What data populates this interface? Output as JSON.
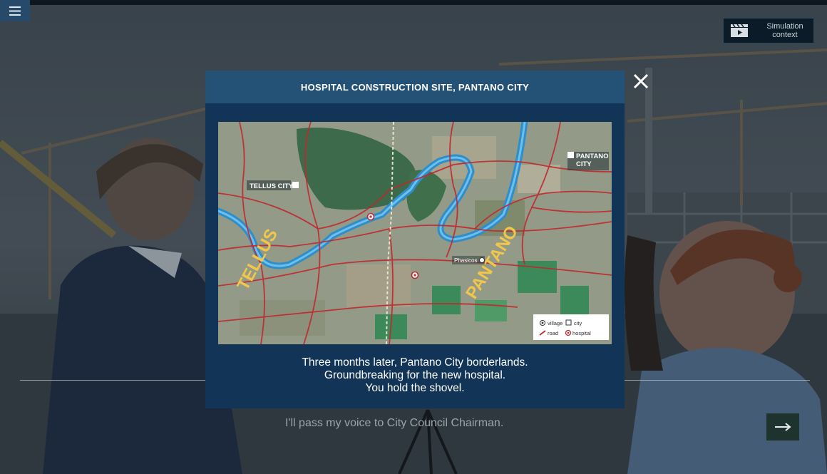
{
  "app": {
    "menu_icon": "hamburger-menu-icon",
    "simulation_context_label": "Simulation\ncontext",
    "simulation_context_icon": "clapperboard-play-icon",
    "dialogue_text": "I'll pass my voice to City Council Chairman.",
    "next_icon": "arrow-right-icon",
    "accent_color": "#123557",
    "header_color": "#245277"
  },
  "modal": {
    "title": "HOSPITAL CONSTRUCTION SITE, PANTANO CITY",
    "close_icon": "close-x-icon",
    "caption_lines": [
      "Three months later, Pantano City borderlands.",
      "Groundbreaking for the new hospital.",
      "You hold the shovel."
    ],
    "map": {
      "region_labels": [
        "TELLUS",
        "PANTANO"
      ],
      "city_labels": [
        "TELLUS CITY",
        "PANTANO CITY"
      ],
      "village_label": "Phasicos",
      "legend": {
        "village": "village",
        "city": "city",
        "road": "road",
        "hospital": "hospital"
      }
    }
  }
}
